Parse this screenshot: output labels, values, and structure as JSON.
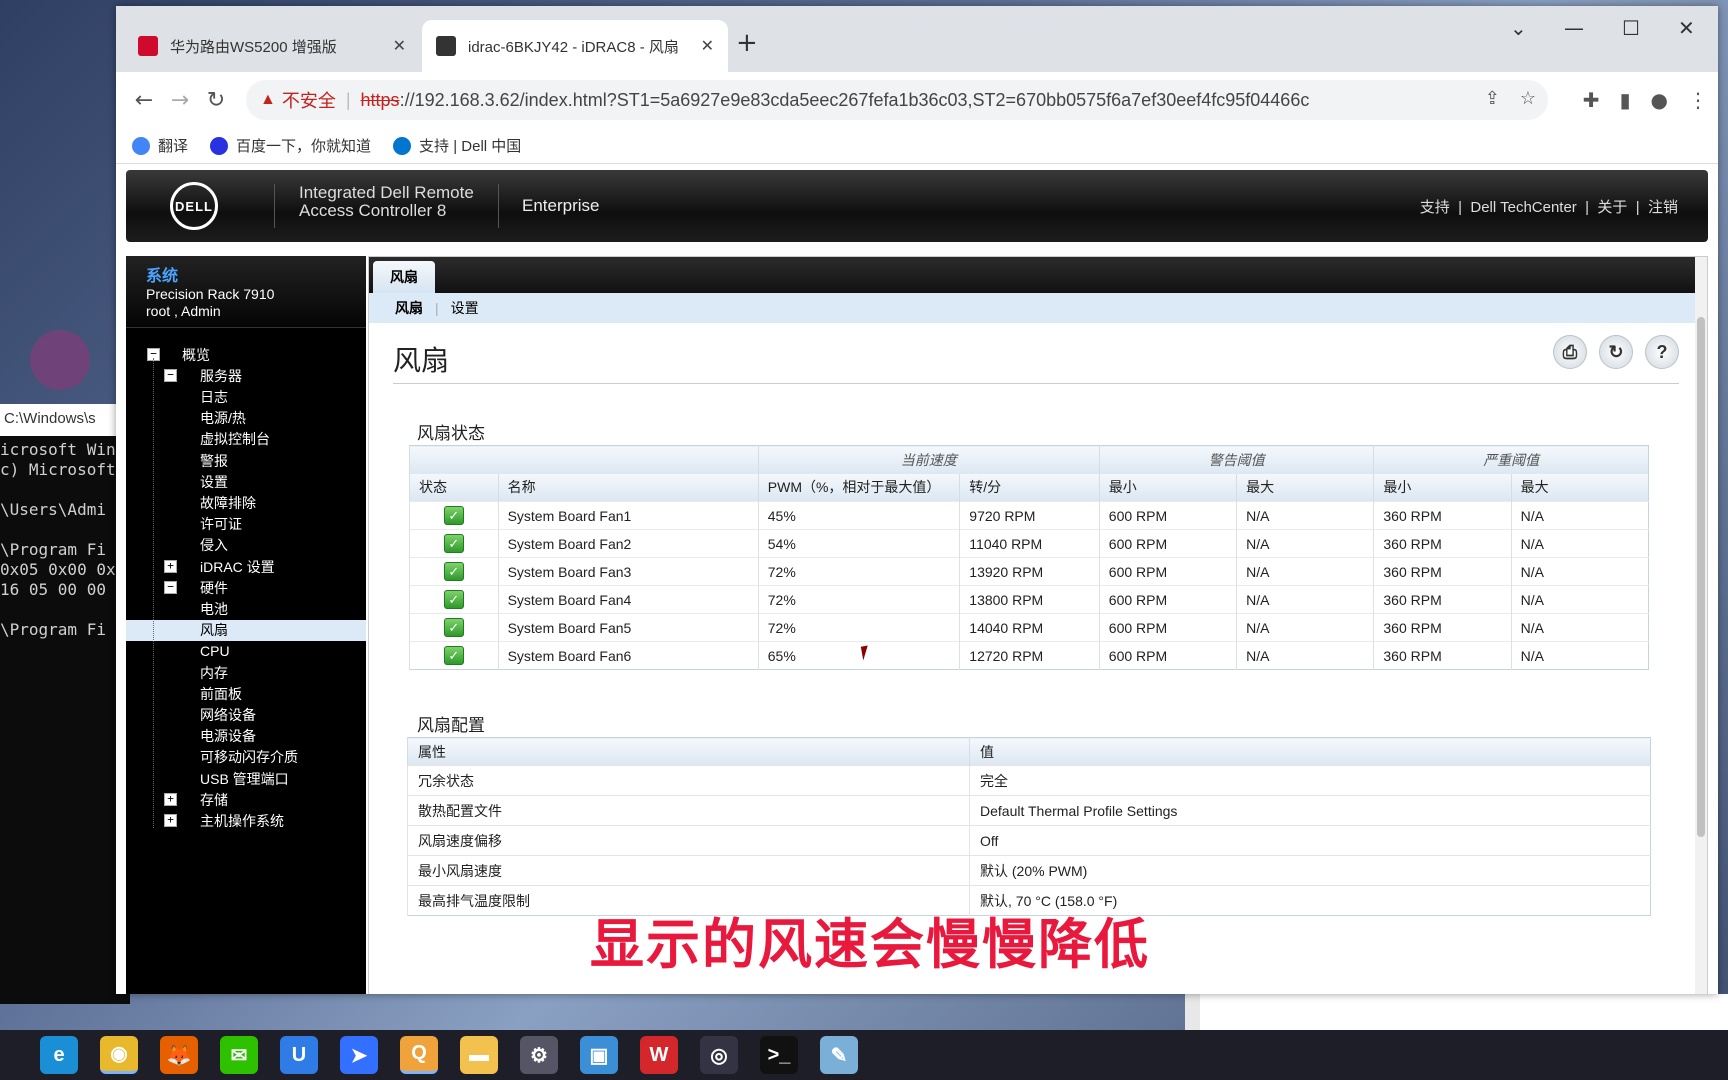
{
  "browser": {
    "tabs": [
      {
        "label": "华为路由WS5200 增强版",
        "icon_color": "#cf0a2c",
        "active": false
      },
      {
        "label": "idrac-6BKJY42 - iDRAC8 - 风扇",
        "icon_color": "#333333",
        "active": true
      }
    ],
    "new_tab": "+",
    "window_controls": {
      "chevron": "⌄",
      "minimize": "—",
      "maximize": "☐",
      "close": "✕"
    },
    "nav": {
      "back": "←",
      "forward": "→",
      "reload": "↻"
    },
    "address": {
      "warning_icon": "▲",
      "insecure": "不安全",
      "separator": "|",
      "scheme": "https",
      "rest": "://192.168.3.62/index.html?ST1=5a6927e9e83cda5eec267fefa1b36c03,ST2=670bb0575f6a7ef30eef4fc95f04466c"
    },
    "toolbar_icons": [
      "share-icon",
      "star-icon",
      "extension-icon",
      "sidebar-icon",
      "profile-icon",
      "menu-icon"
    ],
    "bookmarks": [
      {
        "label": "翻译",
        "icon_color": "#4285f4"
      },
      {
        "label": "百度一下，你就知道",
        "icon_color": "#2932e1"
      },
      {
        "label": "支持 | Dell 中国",
        "icon_color": "#0076ce"
      }
    ]
  },
  "header": {
    "logo": "DELL",
    "title_line1": "Integrated Dell Remote",
    "title_line2": "Access Controller 8",
    "edition": "Enterprise",
    "links": [
      "支持",
      "Dell TechCenter",
      "关于",
      "注销"
    ]
  },
  "sidebar": {
    "system_label": "系统",
    "model": "Precision Rack 7910",
    "user": "root , Admin",
    "tree": [
      {
        "label": "概览",
        "level": 0,
        "toggle": "−"
      },
      {
        "label": "服务器",
        "level": 1,
        "toggle": "−"
      },
      {
        "label": "日志",
        "level": 2
      },
      {
        "label": "电源/热",
        "level": 2
      },
      {
        "label": "虚拟控制台",
        "level": 2
      },
      {
        "label": "警报",
        "level": 2
      },
      {
        "label": "设置",
        "level": 2
      },
      {
        "label": "故障排除",
        "level": 2
      },
      {
        "label": "许可证",
        "level": 2
      },
      {
        "label": "侵入",
        "level": 2
      },
      {
        "label": "iDRAC 设置",
        "level": 1,
        "toggle": "+"
      },
      {
        "label": "硬件",
        "level": 1,
        "toggle": "−"
      },
      {
        "label": "电池",
        "level": 2
      },
      {
        "label": "风扇",
        "level": 2,
        "selected": true
      },
      {
        "label": "CPU",
        "level": 2
      },
      {
        "label": "内存",
        "level": 2
      },
      {
        "label": "前面板",
        "level": 2
      },
      {
        "label": "网络设备",
        "level": 2
      },
      {
        "label": "电源设备",
        "level": 2
      },
      {
        "label": "可移动闪存介质",
        "level": 2
      },
      {
        "label": "USB 管理端口",
        "level": 2
      },
      {
        "label": "存储",
        "level": 1,
        "toggle": "+"
      },
      {
        "label": "主机操作系统",
        "level": 1,
        "toggle": "+"
      }
    ]
  },
  "main": {
    "tab": "风扇",
    "subtabs": [
      "风扇",
      "设置"
    ],
    "title": "风扇",
    "icons": [
      "print-icon",
      "refresh-icon",
      "help-icon"
    ],
    "fan_status": {
      "section_title": "风扇状态",
      "groups": {
        "current_speed": "当前速度",
        "warning": "警告阈值",
        "critical": "严重阈值"
      },
      "columns": [
        "状态",
        "名称",
        "PWM（%，相对于最大值）",
        "转/分",
        "最小",
        "最大",
        "最小",
        "最大"
      ],
      "rows": [
        {
          "name": "System Board Fan1",
          "pwm": "45%",
          "rpm": "9720 RPM",
          "warn_min": "600 RPM",
          "warn_max": "N/A",
          "crit_min": "360 RPM",
          "crit_max": "N/A"
        },
        {
          "name": "System Board Fan2",
          "pwm": "54%",
          "rpm": "11040 RPM",
          "warn_min": "600 RPM",
          "warn_max": "N/A",
          "crit_min": "360 RPM",
          "crit_max": "N/A"
        },
        {
          "name": "System Board Fan3",
          "pwm": "72%",
          "rpm": "13920 RPM",
          "warn_min": "600 RPM",
          "warn_max": "N/A",
          "crit_min": "360 RPM",
          "crit_max": "N/A"
        },
        {
          "name": "System Board Fan4",
          "pwm": "72%",
          "rpm": "13800 RPM",
          "warn_min": "600 RPM",
          "warn_max": "N/A",
          "crit_min": "360 RPM",
          "crit_max": "N/A"
        },
        {
          "name": "System Board Fan5",
          "pwm": "72%",
          "rpm": "14040 RPM",
          "warn_min": "600 RPM",
          "warn_max": "N/A",
          "crit_min": "360 RPM",
          "crit_max": "N/A"
        },
        {
          "name": "System Board Fan6",
          "pwm": "65%",
          "rpm": "12720 RPM",
          "warn_min": "600 RPM",
          "warn_max": "N/A",
          "crit_min": "360 RPM",
          "crit_max": "N/A"
        }
      ]
    },
    "fan_config": {
      "section_title": "风扇配置",
      "columns": [
        "属性",
        "值"
      ],
      "rows": [
        {
          "attr": "冗余状态",
          "value": "完全"
        },
        {
          "attr": "散热配置文件",
          "value": "Default Thermal Profile Settings"
        },
        {
          "attr": "风扇速度偏移",
          "value": "Off"
        },
        {
          "attr": "最小风扇速度",
          "value": "默认 (20% PWM)"
        },
        {
          "attr": "最高排气温度限制",
          "value": "默认, 70 °C (158.0 °F)"
        }
      ]
    }
  },
  "overlay_caption": "显示的风速会慢慢降低",
  "background": {
    "cmd_title": "C:\\Windows\\s",
    "cmd_lines": [
      "icrosoft Win",
      "c) Microsoft",
      "",
      "\\Users\\Admi",
      "",
      "\\Program Fi",
      "0x05 0x00 0x",
      "16 05 00 00 0",
      "",
      "\\Program Fi"
    ]
  },
  "taskbar": {
    "apps": [
      {
        "name": "edge",
        "glyph": "e",
        "color": "#1b8fd6"
      },
      {
        "name": "chrome",
        "glyph": "◉",
        "color": "#e9b92d",
        "active": true
      },
      {
        "name": "firefox",
        "glyph": "🦊",
        "color": "#e66000"
      },
      {
        "name": "wechat",
        "glyph": "✉",
        "color": "#2dc100"
      },
      {
        "name": "app-u",
        "glyph": "U",
        "color": "#2f7ce6"
      },
      {
        "name": "feishu",
        "glyph": "➤",
        "color": "#3370ff"
      },
      {
        "name": "search-tool",
        "glyph": "Q",
        "color": "#f0a33a",
        "active": true
      },
      {
        "name": "explorer",
        "glyph": "▬",
        "color": "#f2c14e"
      },
      {
        "name": "settings",
        "glyph": "⚙",
        "color": "#555566"
      },
      {
        "name": "control-panel",
        "glyph": "▣",
        "color": "#3a8fd6"
      },
      {
        "name": "wps",
        "glyph": "W",
        "color": "#d4272b"
      },
      {
        "name": "screen-rec",
        "glyph": "◎",
        "color": "#333344"
      },
      {
        "name": "terminal",
        "glyph": ">_",
        "color": "#111111"
      },
      {
        "name": "notepad",
        "glyph": "✎",
        "color": "#7ab0d8"
      }
    ]
  }
}
